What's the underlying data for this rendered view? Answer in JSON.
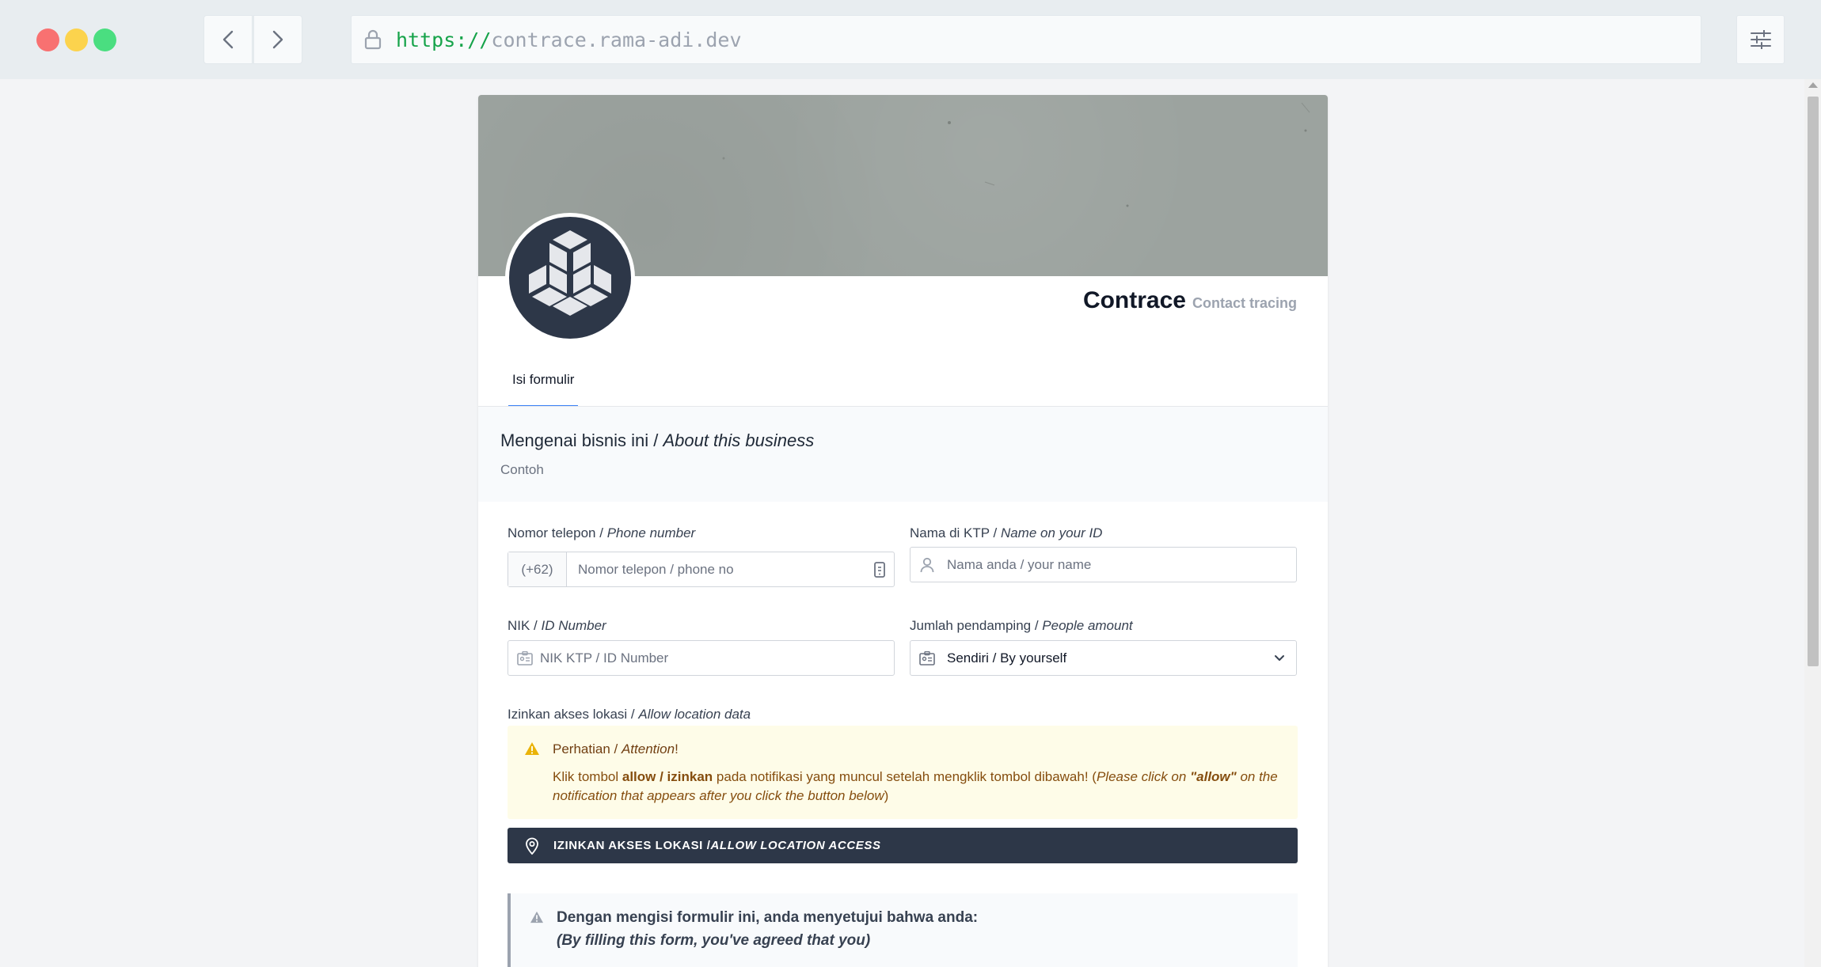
{
  "browser": {
    "url_protocol": "https://",
    "url_host": "contrace.rama-adi.dev"
  },
  "header": {
    "brand_name": "Contrace",
    "brand_subtitle": "Contact tracing"
  },
  "tabs": [
    {
      "label": "Isi formulir",
      "active": true
    }
  ],
  "about": {
    "title_id": "Mengenai bisnis ini / ",
    "title_en": "About this business",
    "subtitle": "Contoh"
  },
  "form": {
    "phone": {
      "label_id": "Nomor telepon / ",
      "label_en": "Phone number",
      "prefix": "(+62)",
      "placeholder": "Nomor telepon / phone no"
    },
    "name": {
      "label_id": "Nama di KTP / ",
      "label_en": "Name on your ID",
      "placeholder": "Nama anda / your name"
    },
    "nik": {
      "label_id": "NIK / ",
      "label_en": "ID Number",
      "placeholder": "NIK KTP / ID Number"
    },
    "people": {
      "label_id": "Jumlah pendamping / ",
      "label_en": "People amount",
      "selected": "Sendiri / By yourself"
    },
    "location": {
      "label_id": "Izinkan akses lokasi / ",
      "label_en": "Allow location data"
    }
  },
  "alert": {
    "title_id": "Perhatian / ",
    "title_en": "Attention",
    "title_end": "!",
    "body_1": "Klik tombol ",
    "body_bold": "allow / izinkan",
    "body_2": " pada notifikasi yang muncul setelah mengklik tombol dibawah! (",
    "body_italic_1": "Please click on ",
    "body_italic_bold": "\"allow\"",
    "body_italic_2": " on the notification that appears after you click the button below",
    "body_end": ")"
  },
  "location_button": {
    "label_id": "IZINKAN AKSES LOKASI /",
    "label_en": "ALLOW LOCATION ACCESS"
  },
  "agreement": {
    "title": "Dengan mengisi formulir ini, anda menyetujui bahwa anda:",
    "subtitle": "(By filling this form, you've agreed that you)"
  }
}
